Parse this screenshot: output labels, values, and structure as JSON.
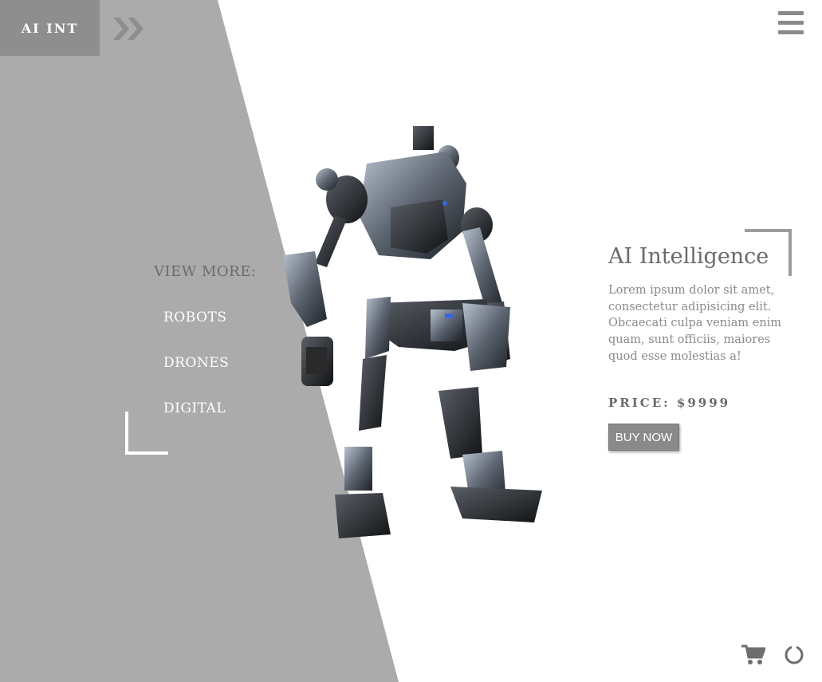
{
  "brand": {
    "logo_text": "AI INT"
  },
  "icons": {
    "forward": "double-chevron-right-icon",
    "menu": "hamburger-menu-icon",
    "cart": "shopping-cart-icon",
    "spinner": "loading-circle-icon"
  },
  "sidebar": {
    "heading": "VIEW MORE:",
    "items": [
      {
        "label": "ROBOTS"
      },
      {
        "label": "DRONES"
      },
      {
        "label": "DIGITAL"
      }
    ]
  },
  "product": {
    "title": "AI Intelligence",
    "description": "Lorem ipsum dolor sit amet, consectetur adipisicing elit. Obcaecati culpa veniam enim quam, sunt officiis, maiores quod esse molestias a!",
    "price": "PRICE: $9999",
    "buy_label": "BUY NOW"
  },
  "colors": {
    "panel_gray": "#ababab",
    "logo_gray": "#8e8e8e",
    "accent_text": "#6a6a6a",
    "white": "#ffffff"
  }
}
